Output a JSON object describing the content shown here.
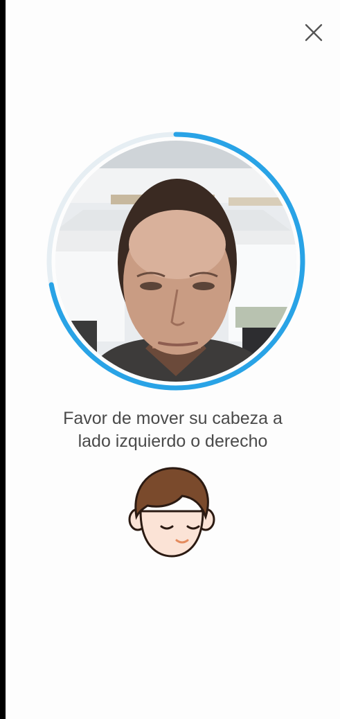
{
  "close": {
    "icon": "close-icon"
  },
  "camera": {
    "progress_color": "#29a3e6",
    "track_color": "#e6eef3",
    "progress_fraction": 0.72
  },
  "instruction": {
    "text": "Favor de mover su cabeza a lado izquierdo o derecho"
  },
  "illustration": {
    "icon": "head-turn-face-icon"
  }
}
